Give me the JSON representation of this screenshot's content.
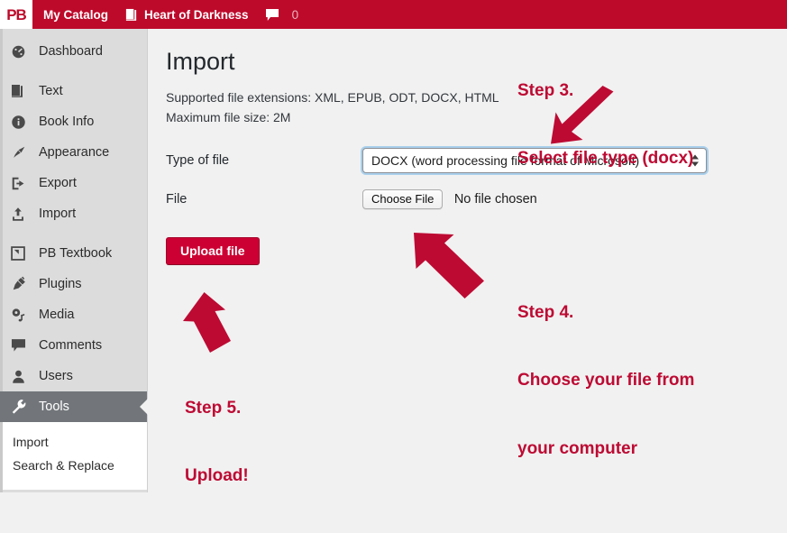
{
  "colors": {
    "brand_red": "#bd0a2b",
    "button_red": "#cc0033",
    "annotation_red": "#bd0a33",
    "sidebar_bg": "#dcdcdc",
    "sidebar_active": "#72767a",
    "content_bg": "#f1f1f1",
    "focus_blue": "#a9d0ec"
  },
  "adminbar": {
    "logo": "PB",
    "logo_icon": "pressbooks-logo-icon",
    "my_catalog": "My Catalog",
    "book_title": "Heart of Darkness",
    "book_icon": "book-icon",
    "comments_icon": "comment-bubble-icon",
    "comments_count": "0"
  },
  "sidebar": {
    "items": [
      {
        "label": "Dashboard",
        "icon": "dashboard-gauge-icon",
        "active": false
      },
      {
        "label": "Text",
        "icon": "book-pages-icon",
        "active": false
      },
      {
        "label": "Book Info",
        "icon": "info-circle-icon",
        "active": false
      },
      {
        "label": "Appearance",
        "icon": "paintbrush-icon",
        "active": false
      },
      {
        "label": "Export",
        "icon": "export-arrow-icon",
        "active": false
      },
      {
        "label": "Import",
        "icon": "import-upload-icon",
        "active": false
      },
      {
        "label": "PB Textbook",
        "icon": "textbook-square-icon",
        "active": false
      },
      {
        "label": "Plugins",
        "icon": "plug-icon",
        "active": false
      },
      {
        "label": "Media",
        "icon": "media-icon",
        "active": false
      },
      {
        "label": "Comments",
        "icon": "comment-bubble-icon",
        "active": false
      },
      {
        "label": "Users",
        "icon": "user-icon",
        "active": false
      },
      {
        "label": "Tools",
        "icon": "wrench-icon",
        "active": true
      }
    ],
    "submenu": [
      {
        "label": "Import"
      },
      {
        "label": "Search & Replace"
      }
    ]
  },
  "main": {
    "title": "Import",
    "supported_extensions": "Supported file extensions: XML, EPUB, ODT, DOCX, HTML",
    "max_file_size": "Maximum file size: 2M",
    "type_of_file_label": "Type of file",
    "type_of_file_value": "DOCX (word processing file format of Microsoft)",
    "file_label": "File",
    "choose_file_button": "Choose File",
    "no_file_chosen": "No file chosen",
    "upload_button": "Upload file"
  },
  "annotations": [
    {
      "id": "step3",
      "line1": "Step 3.",
      "line2": "Select file type (docx)"
    },
    {
      "id": "step4",
      "line1": "Step 4.",
      "line2": "Choose your file from",
      "line3": "your computer"
    },
    {
      "id": "step5",
      "line1": "Step 5.",
      "line2": "Upload!"
    }
  ],
  "arrows": [
    {
      "id": "arrow-to-select",
      "direction": "down-left"
    },
    {
      "id": "arrow-to-choose-file",
      "direction": "up-left"
    },
    {
      "id": "arrow-to-upload",
      "direction": "up"
    }
  ]
}
